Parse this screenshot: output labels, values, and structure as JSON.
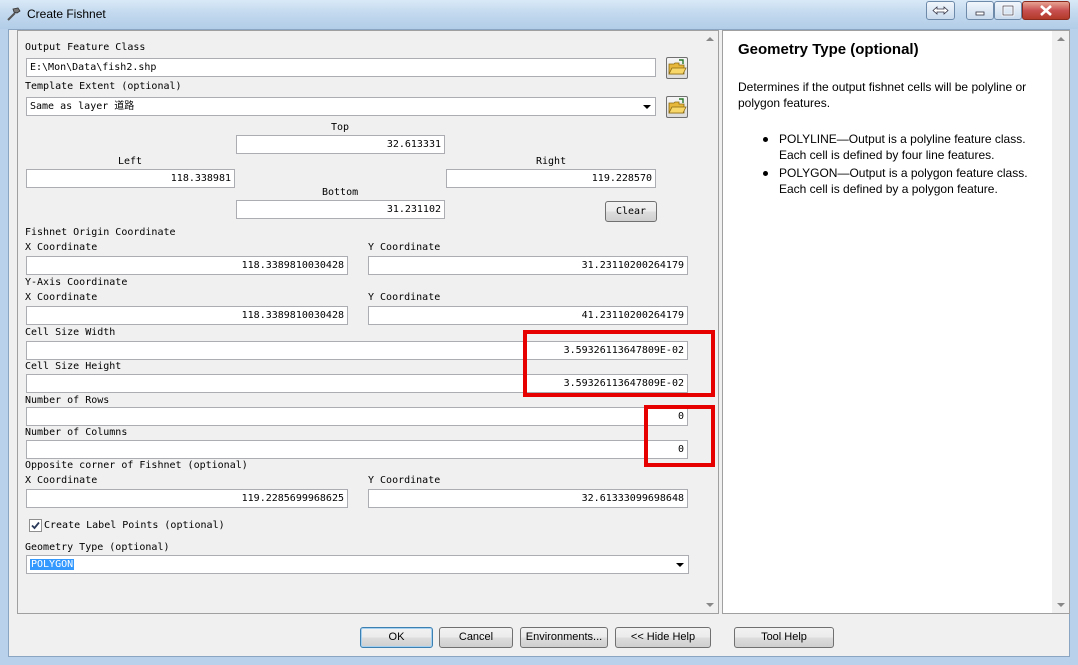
{
  "window": {
    "title": "Create Fishnet"
  },
  "form": {
    "output_feature_class": {
      "label": "Output Feature Class",
      "value": "E:\\Mon\\Data\\fish2.shp"
    },
    "template_extent": {
      "label": "Template Extent (optional)",
      "value": "Same as layer 道路"
    },
    "extent": {
      "top_label": "Top",
      "top_value": "32.613331",
      "left_label": "Left",
      "left_value": "118.338981",
      "right_label": "Right",
      "right_value": "119.228570",
      "bottom_label": "Bottom",
      "bottom_value": "31.231102",
      "clear_label": "Clear"
    },
    "origin": {
      "label": "Fishnet Origin Coordinate",
      "x_label": "X Coordinate",
      "x_value": "118.3389810030428",
      "y_label": "Y Coordinate",
      "y_value": "31.23110200264179"
    },
    "yaxis": {
      "label": "Y-Axis Coordinate",
      "x_label": "X Coordinate",
      "x_value": "118.3389810030428",
      "y_label": "Y Coordinate",
      "y_value": "41.23110200264179"
    },
    "cell_width": {
      "label": "Cell Size Width",
      "value": "3.59326113647809E-02"
    },
    "cell_height": {
      "label": "Cell Size Height",
      "value": "3.59326113647809E-02"
    },
    "rows": {
      "label": "Number of Rows",
      "value": "0"
    },
    "columns": {
      "label": "Number of Columns",
      "value": "0"
    },
    "opposite": {
      "label": "Opposite corner of Fishnet (optional)",
      "x_label": "X Coordinate",
      "x_value": "119.2285699968625",
      "y_label": "Y Coordinate",
      "y_value": "32.61333099698648"
    },
    "label_points": {
      "label": "Create Label Points (optional)",
      "checked": true
    },
    "geometry_type": {
      "label": "Geometry Type (optional)",
      "value": "POLYGON"
    }
  },
  "help": {
    "title": "Geometry Type (optional)",
    "intro": "Determines if the output fishnet cells will be polyline or polygon features.",
    "items": [
      "POLYLINE—Output is a polyline feature class. Each cell is defined by four line features.",
      "POLYGON—Output is a polygon feature class. Each cell is defined by a polygon feature."
    ]
  },
  "buttons": {
    "ok": "OK",
    "cancel": "Cancel",
    "environments": "Environments...",
    "hide_help": "<< Hide Help",
    "tool_help": "Tool Help"
  },
  "colors": {
    "highlight_box": "#e60000",
    "selection": "#3399ff"
  }
}
